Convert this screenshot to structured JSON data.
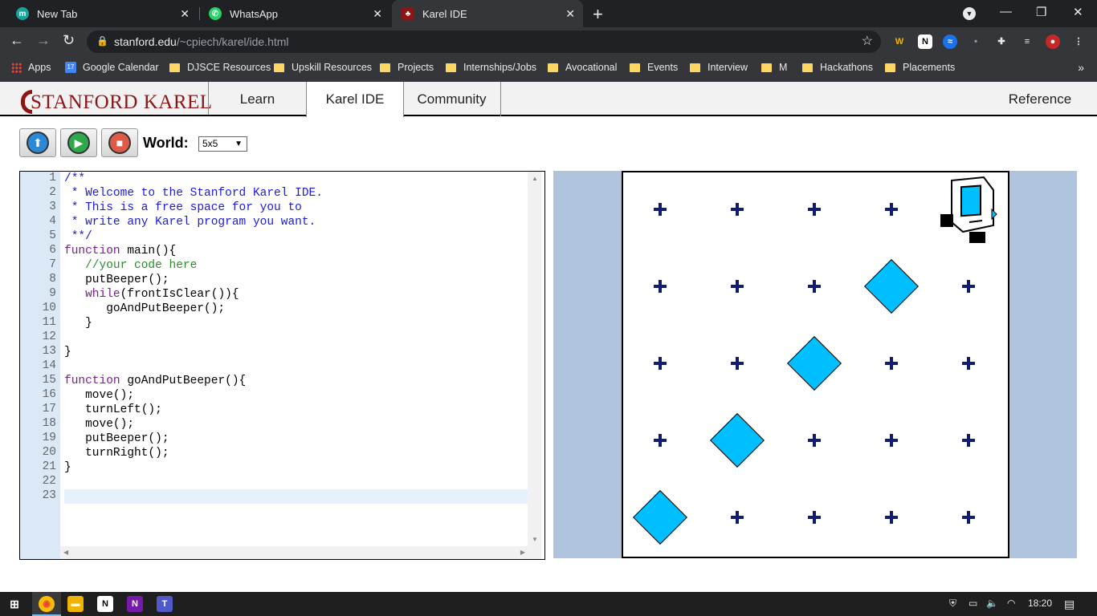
{
  "browser": {
    "tabs": [
      {
        "title": "New Tab",
        "icon": "m-letter-icon"
      },
      {
        "title": "WhatsApp",
        "icon": "whatsapp-icon"
      },
      {
        "title": "Karel IDE",
        "icon": "stanford-tree-icon"
      }
    ],
    "url_host": "stanford.edu",
    "url_path": "/~cpiech/karel/ide.html",
    "bookmarks": [
      "Apps",
      "Google Calendar",
      "DJSCE Resources",
      "Upskill Resources",
      "Projects",
      "Internships/Jobs",
      "Avocational",
      "Events",
      "Interview",
      "M",
      "Hackathons",
      "Placements"
    ]
  },
  "karel": {
    "logo_text": "STANFORD KAREL",
    "nav": [
      "Learn",
      "Karel IDE",
      "Community",
      "Reference"
    ],
    "world_label": "World:",
    "world_value": "5x5",
    "world_size": 5
  },
  "editor": {
    "lines": [
      "/**",
      " * Welcome to the Stanford Karel IDE.",
      " * This is a free space for you to",
      " * write any Karel program you want.",
      " **/",
      "function main(){",
      "   //your code here",
      "   putBeeper();",
      "   while(frontIsClear()){",
      "      goAndPutBeeper();",
      "   }",
      "",
      "}",
      "",
      "function goAndPutBeeper(){",
      "   move();",
      "   turnLeft();",
      "   move();",
      "   putBeeper();",
      "   turnRight();",
      "}",
      "",
      ""
    ],
    "current_line": 23
  },
  "world": {
    "beepers": [
      [
        1,
        1
      ],
      [
        2,
        2
      ],
      [
        3,
        3
      ],
      [
        4,
        4
      ]
    ],
    "karel": {
      "avenue": 5,
      "street": 5,
      "facing": "east"
    }
  },
  "taskbar": {
    "time": "18:20"
  }
}
